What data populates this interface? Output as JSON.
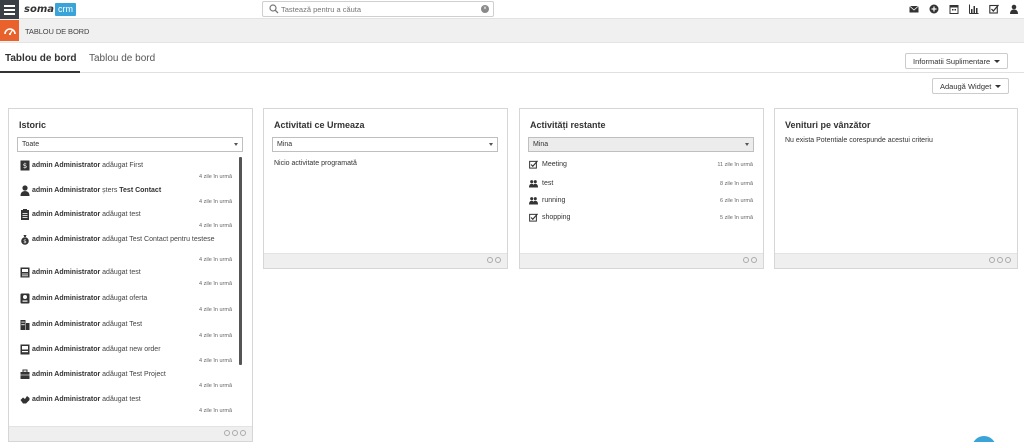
{
  "brand": {
    "name": "soma",
    "suffix": "crm"
  },
  "search": {
    "placeholder": "Tastează pentru a căuta"
  },
  "top_icons": [
    "envelope-icon",
    "plus-circle-icon",
    "calendar-icon",
    "bar-chart-icon",
    "checkbox-icon",
    "user-icon"
  ],
  "page": {
    "title": "TABLOU DE BORD"
  },
  "tabs": [
    {
      "label": "Tablou de bord"
    },
    {
      "label": "Tablou de bord"
    }
  ],
  "buttons": {
    "info": "Informatii Suplimentare",
    "add_widget": "Adaugă Widget"
  },
  "colors": {
    "accent_orange": "#e9622b",
    "brand_blue": "#3aa3d8",
    "sidebar_dark": "#3b3f46"
  },
  "widgets": {
    "history": {
      "title": "Istoric",
      "filter": "Toate",
      "items": [
        {
          "user": "admin Administrator",
          "action": "adăugat First",
          "time": "4 zile în urmă"
        },
        {
          "user": "admin Administrator",
          "action": "șters",
          "target": "Test Contact",
          "time": "4 zile în urmă"
        },
        {
          "user": "admin Administrator",
          "action": "adăugat test",
          "time": "4 zile în urmă"
        },
        {
          "user": "admin Administrator",
          "action": "adăugat Test Contact pentru testese",
          "time": "4 zile în urmă"
        },
        {
          "user": "admin Administrator",
          "action": "adăugat test",
          "time": "4 zile în urmă"
        },
        {
          "user": "admin Administrator",
          "action": "adăugat oferta",
          "time": "4 zile în urmă"
        },
        {
          "user": "admin Administrator",
          "action": "adăugat Test",
          "time": "4 zile în urmă"
        },
        {
          "user": "admin Administrator",
          "action": "adăugat new order",
          "time": "4 zile în urmă"
        },
        {
          "user": "admin Administrator",
          "action": "adăugat Test Project",
          "time": "4 zile în urmă"
        },
        {
          "user": "admin Administrator",
          "action": "adăugat test",
          "time": "4 zile în urmă"
        }
      ]
    },
    "upcoming": {
      "title": "Activitati ce Urmeaza",
      "filter": "Mina",
      "empty": "Nicio activitate programată"
    },
    "overdue": {
      "title": "Activități restante",
      "filter": "Mina",
      "items": [
        {
          "label": "Meeting",
          "when": "11 zile în urmă",
          "icon": "checkbox-icon"
        },
        {
          "label": "test",
          "when": "8 zile în urmă",
          "icon": "people-icon"
        },
        {
          "label": "running",
          "when": "6 zile în urmă",
          "icon": "people-icon"
        },
        {
          "label": "shopping",
          "when": "5 zile în urmă",
          "icon": "checkbox-icon"
        }
      ]
    },
    "revenue": {
      "title": "Venituri pe vânzător",
      "empty": "Nu exista Potentiale corespunde acestui criteriu"
    }
  }
}
